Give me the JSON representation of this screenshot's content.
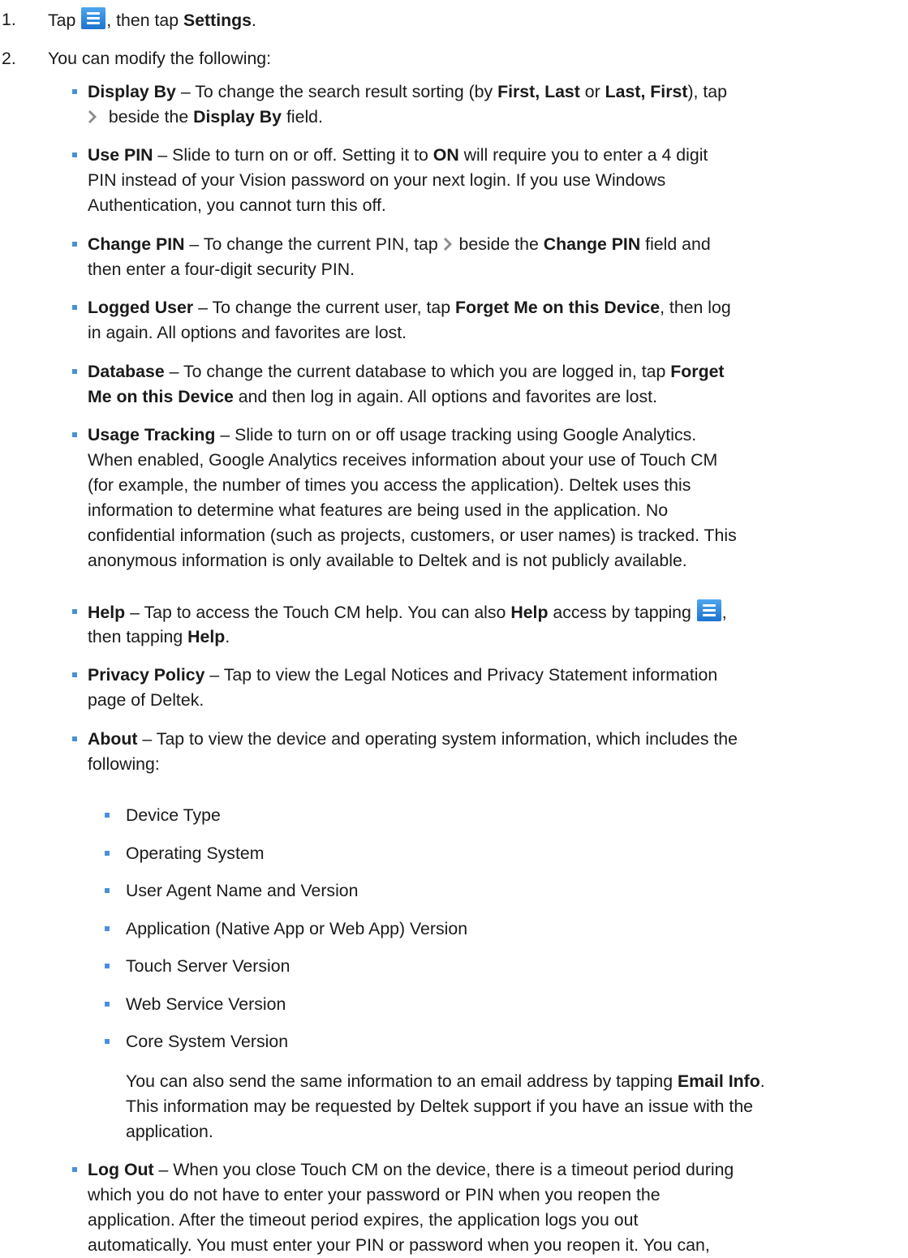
{
  "steps": [
    {
      "num": "1.",
      "pre": "Tap ",
      "mid": ", then tap ",
      "bold": "Settings",
      "post": "."
    },
    {
      "num": "2.",
      "text": "You can modify the following:"
    }
  ],
  "items": {
    "display_by": {
      "l1a": "Display By",
      "l1b": " – To change the search result sorting (by ",
      "l1c": "First, Last",
      "l1d": " or ",
      "l1e": "Last, First",
      "l1f": "), tap",
      "l2a": " beside the ",
      "l2b": "Display By",
      "l2c": " field."
    },
    "use_pin": {
      "t": "Use PIN",
      "l1a": "  – Slide to turn on or off. Setting it to ",
      "l1b": "ON",
      "l1c": " will require you to enter a 4 digit",
      "l2": "PIN instead of your Vision password on your next login. If you use Windows",
      "l3": "Authentication, you cannot turn this off."
    },
    "change_pin": {
      "t": "Change PIN",
      "l1a": " – To change the current PIN, tap ",
      "l1b": " beside the ",
      "l1c": "Change PIN",
      "l1d": " field and",
      "l2": "then enter a four-digit security PIN."
    },
    "logged_user": {
      "t": "Logged User",
      "l1a": " – To change the current user, tap ",
      "l1b": "Forget Me on this Device",
      "l1c": ", then log",
      "l2": "in again. All options and favorites are lost."
    },
    "database": {
      "t": "Database",
      "l1a": " – To change the current database to which you are logged in, tap ",
      "l1b": "Forget",
      "l2a": "Me on this Device",
      "l2b": " and then log in again. All options and favorites are lost."
    },
    "usage_tracking": {
      "t": "Usage Tracking",
      "l1": " – Slide to turn on or off usage tracking using Google Analytics.",
      "l2": "When enabled, Google Analytics receives information about your use of Touch CM",
      "l3": "(for example, the number of times you access the application). Deltek uses this",
      "l4": "information to determine what features are being used in the application. No",
      "l5": "confidential information (such as projects, customers, or user names) is tracked. This",
      "l6": "anonymous information is only available to Deltek and is not publicly available."
    },
    "help": {
      "t": "Help",
      "l1a": " – Tap to access the Touch CM help. You can also ",
      "l1b": "Help",
      "l1c": " access by tapping ",
      "l1d": ",",
      "l2a": "then tapping ",
      "l2b": "Help",
      "l2c": "."
    },
    "privacy": {
      "t": "Privacy Policy",
      "l1": " – Tap to view the Legal Notices and Privacy Statement information",
      "l2": "page of Deltek."
    },
    "about": {
      "t": "About",
      "l1": " – Tap to view the device and operating system information, which includes the",
      "l2": "following:"
    },
    "about_list": [
      "Device Type",
      "Operating System",
      "User Agent Name and Version",
      "Application (Native App or Web App) Version",
      "Touch Server Version",
      "Web Service Version",
      "Core System Version"
    ],
    "email_para": {
      "l1a": "You can also send the same information to an email address by tapping ",
      "l1b": "Email Info",
      "l1c": ".",
      "l2": "This information may be requested by Deltek support if you have an issue with the",
      "l3": "application."
    },
    "logout": {
      "t": "Log Out",
      "l1": " – When you close Touch CM on the device, there is a timeout period during",
      "l2": "which you do not have to enter your password or PIN when you reopen the",
      "l3": "application. After the timeout period expires, the application logs you out",
      "l4": "automatically. You must enter your PIN or password when you reopen it.  You can,"
    }
  }
}
